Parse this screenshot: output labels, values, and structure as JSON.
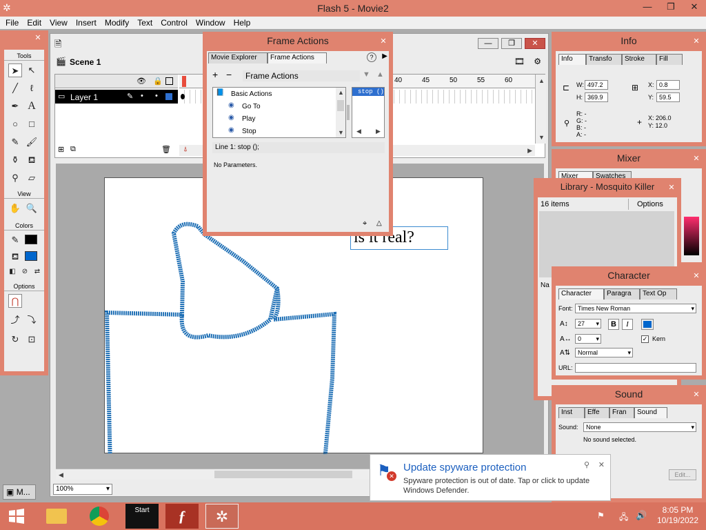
{
  "window": {
    "title": "Flash 5 - Movie2",
    "minimize": "—",
    "maximize": "❐",
    "close": "✕"
  },
  "menu": [
    "File",
    "Edit",
    "View",
    "Insert",
    "Modify",
    "Text",
    "Control",
    "Window",
    "Help"
  ],
  "toolbox": {
    "title": "Tools",
    "view_label": "View",
    "colors_label": "Colors",
    "options_label": "Options",
    "stroke_color": "#000000",
    "fill_color": "#0066cc"
  },
  "document": {
    "scene": "Scene 1",
    "layer": "Layer 1",
    "frame_numbers": [
      "40",
      "45",
      "50",
      "55",
      "60"
    ],
    "zoom": "100%",
    "stage_text": "is it real?",
    "drawing_color": "#1e6fb5"
  },
  "frame_actions": {
    "title": "Frame Actions",
    "tabs": [
      "Movie Explorer",
      "Frame Actions"
    ],
    "toolbar_label": "Frame Actions",
    "category": "Basic Actions",
    "actions": [
      "Go To",
      "Play",
      "Stop"
    ],
    "script_line": "stop ()",
    "status": "Line 1: stop ();",
    "params": "No Parameters."
  },
  "info": {
    "title": "Info",
    "tabs": [
      "Info",
      "Transfo",
      "Stroke",
      "Fill"
    ],
    "w_label": "W:",
    "w": "497.2",
    "h_label": "H:",
    "h": "369.9",
    "x_label": "X:",
    "x": "0.8",
    "y_label": "Y:",
    "y": "59.5",
    "r_label": "R:",
    "r": "-",
    "g_label": "G:",
    "g": "-",
    "b_label": "B:",
    "b": "-",
    "a_label": "A:",
    "a": "-",
    "cx_label": "X:",
    "cx": "206.0",
    "cy_label": "Y:",
    "cy": "12.0"
  },
  "mixer": {
    "title": "Mixer",
    "tabs": [
      "Mixer",
      "Swatches"
    ]
  },
  "library": {
    "title": "Library - Mosquito Killer",
    "count": "16 items",
    "options": "Options",
    "name_col": "Na"
  },
  "character": {
    "title": "Character",
    "tabs": [
      "Character",
      "Paragra",
      "Text Op"
    ],
    "font_label": "Font:",
    "font": "Times New Roman",
    "size": "27",
    "bold": "B",
    "italic": "I",
    "tracking": "0",
    "kern": "Kern",
    "baseline": "Normal",
    "url_label": "URL:",
    "color": "#0066cc"
  },
  "sound": {
    "title": "Sound",
    "tabs": [
      "Inst",
      "Effe",
      "Fran",
      "Sound"
    ],
    "sound_label": "Sound:",
    "sound": "None",
    "status": "No sound selected.",
    "edit": "Edit..."
  },
  "toast": {
    "title": "Update spyware protection",
    "body": "Spyware protection is out of date. Tap or click to update Windows Defender."
  },
  "taskbar": {
    "task_label": "M...",
    "start_label": "Start",
    "time": "8:05 PM",
    "date": "10/19/2022"
  }
}
